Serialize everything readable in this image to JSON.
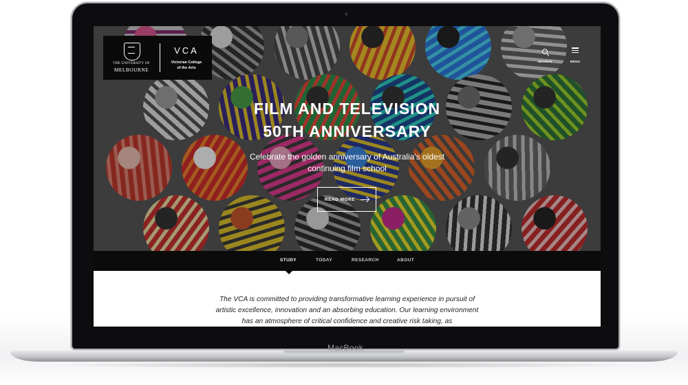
{
  "device": {
    "label": "MacBook"
  },
  "header": {
    "university_line1": "THE UNIVERSITY OF",
    "university_line2": "MELBOURNE",
    "school_abbrev": "VCA",
    "school_name_line1": "Victorian College",
    "school_name_line2": "of the Arts",
    "search_label": "SEARCH",
    "menu_label": "MENU"
  },
  "hero": {
    "title_line1": "FILM AND TELEVISION",
    "title_line2": "50TH ANNIVERSARY",
    "subtitle": "Celebrate the golden anniversary of Australia's oldest continuing film school",
    "cta_label": "READ MORE"
  },
  "nav": {
    "items": [
      {
        "label": "STUDY",
        "active": true
      },
      {
        "label": "TODAY",
        "active": false
      },
      {
        "label": "RESEARCH",
        "active": false
      },
      {
        "label": "ABOUT",
        "active": false
      }
    ]
  },
  "intro": {
    "text_lead": "The VCA",
    "text_rest": " is committed to providing transformative learning experience in pursuit of artistic excellence, innovation and an absorbing education. Our learning environment has an atmosphere of critical confidence and creative risk taking, as"
  },
  "colors": {
    "nav_background": "#0b0b0b",
    "logo_background": "#0a0a0a",
    "hero_overlay": "#4a4a4a"
  }
}
